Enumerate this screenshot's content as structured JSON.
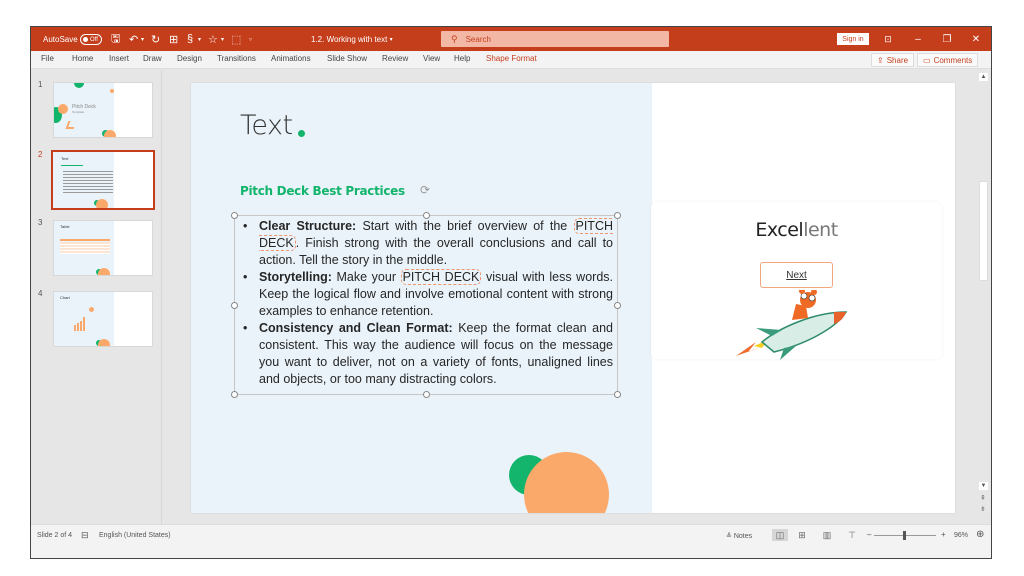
{
  "titlebar": {
    "autosave_label": "AutoSave",
    "autosave_state": "Off",
    "quick_access": [
      "save-icon",
      "undo-icon",
      "redo-icon",
      "present-icon",
      "format-painter-icon",
      "shapes-icon",
      "select-icon",
      "customize-icon"
    ],
    "document_title": "1.2. Working with text",
    "document_title_caret": "▾",
    "search_placeholder": "Search",
    "sign_in_label": "Sign in",
    "ribbon_display_icon": "ribbon-display-icon",
    "minimize": "–",
    "restore": "❐",
    "close": "✕"
  },
  "ribbon": {
    "tabs": [
      "File",
      "Home",
      "Insert",
      "Draw",
      "Design",
      "Transitions",
      "Animations",
      "Slide Show",
      "Review",
      "View",
      "Help",
      "Shape Format"
    ],
    "active_tab": "Shape Format",
    "share_label": "Share",
    "comments_label": "Comments"
  },
  "thumbnails": [
    {
      "number": "1",
      "title": "Pitch Deck",
      "subtitle": "Template",
      "selected": false
    },
    {
      "number": "2",
      "title": "Text",
      "selected": true
    },
    {
      "number": "3",
      "title": "Table",
      "selected": false
    },
    {
      "number": "4",
      "title": "Chart",
      "selected": false
    }
  ],
  "slide": {
    "title": "Text",
    "subtitle": "Pitch Deck Best Practices",
    "bullets": [
      {
        "bold": "Clear Structure:",
        "pre": " Start with the brief overview of the ",
        "highlight": "PITCH DECK",
        "post": ". Finish strong with the overall conclusions and call to action. Tell the story in the middle."
      },
      {
        "bold": "Storytelling:",
        "pre": " Make your ",
        "highlight": "PITCH DECK",
        "post": " visual with less words. Keep the logical flow and involve emotional content with strong examples to enhance retention."
      },
      {
        "bold": "Consistency and Clean Format:",
        "pre": " Keep the format clean and consistent. This way the audience will focus on the message you want to deliver, not on a variety of fonts, unaligned lines and objects, or too many distracting colors.",
        "highlight": "",
        "post": ""
      }
    ],
    "feedback": {
      "word_strong": "Excel",
      "word_fade": "lent",
      "next_button": "Next"
    },
    "colors": {
      "green": "#13b46c",
      "orange": "#fba96a",
      "panel": "#eaf3fa",
      "accent": "#c43e1c"
    }
  },
  "statusbar": {
    "slide_indicator": "Slide 2 of 4",
    "language": "English (United States)",
    "notes_label": "Notes",
    "zoom_minus": "–",
    "zoom_plus": "+",
    "zoom_level": "96%",
    "zoom_fraction": 0.48
  }
}
